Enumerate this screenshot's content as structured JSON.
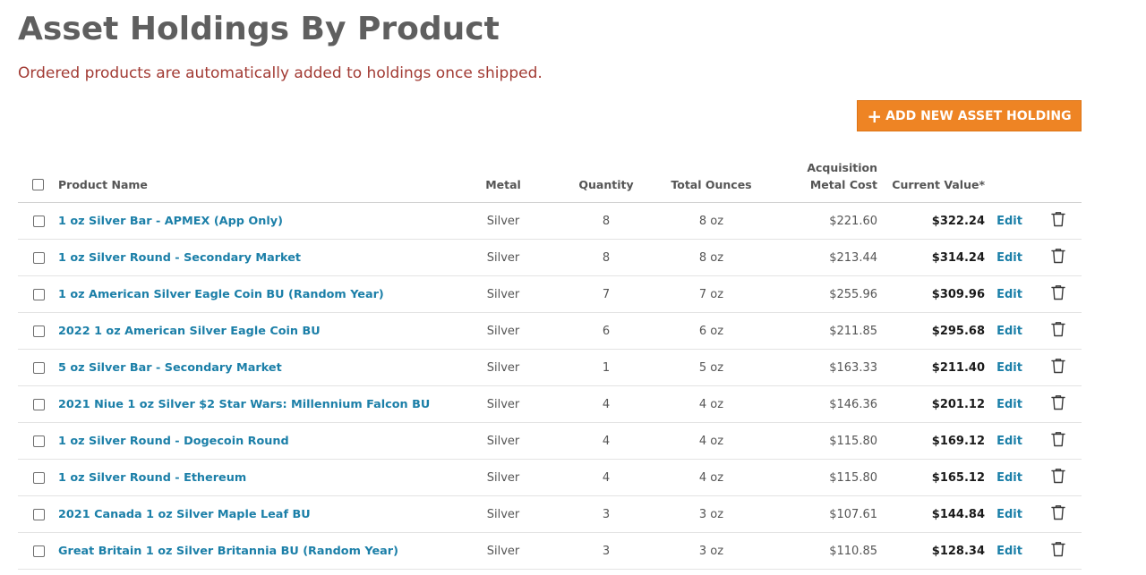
{
  "header": {
    "title": "Asset Holdings By Product",
    "notice": "Ordered products are automatically added to holdings once shipped."
  },
  "actions": {
    "add_label": "ADD NEW ASSET HOLDING",
    "add_icon": "plus-icon"
  },
  "colors": {
    "accent_button": "#ee8424",
    "link": "#1b7fa8",
    "notice": "#a23b34",
    "title": "#5f5f5f"
  },
  "table": {
    "columns": {
      "product_name": "Product Name",
      "metal": "Metal",
      "quantity": "Quantity",
      "total_ounces": "Total Ounces",
      "acquisition_line1": "Acquisition",
      "acquisition_line2": "Metal Cost",
      "current_value": "Current Value*"
    },
    "edit_label": "Edit",
    "delete_icon": "trash-icon",
    "rows": [
      {
        "name": "1 oz Silver Bar - APMEX (App Only)",
        "metal": "Silver",
        "quantity": "8",
        "ounces": "8 oz",
        "cost": "$221.60",
        "value": "$322.24"
      },
      {
        "name": "1 oz Silver Round - Secondary Market",
        "metal": "Silver",
        "quantity": "8",
        "ounces": "8 oz",
        "cost": "$213.44",
        "value": "$314.24"
      },
      {
        "name": "1 oz American Silver Eagle Coin BU (Random Year)",
        "metal": "Silver",
        "quantity": "7",
        "ounces": "7 oz",
        "cost": "$255.96",
        "value": "$309.96"
      },
      {
        "name": "2022 1 oz American Silver Eagle Coin BU",
        "metal": "Silver",
        "quantity": "6",
        "ounces": "6 oz",
        "cost": "$211.85",
        "value": "$295.68"
      },
      {
        "name": "5 oz Silver Bar - Secondary Market",
        "metal": "Silver",
        "quantity": "1",
        "ounces": "5 oz",
        "cost": "$163.33",
        "value": "$211.40"
      },
      {
        "name": "2021 Niue 1 oz Silver $2 Star Wars: Millennium Falcon BU",
        "metal": "Silver",
        "quantity": "4",
        "ounces": "4 oz",
        "cost": "$146.36",
        "value": "$201.12"
      },
      {
        "name": "1 oz Silver Round - Dogecoin Round",
        "metal": "Silver",
        "quantity": "4",
        "ounces": "4 oz",
        "cost": "$115.80",
        "value": "$169.12"
      },
      {
        "name": "1 oz Silver Round - Ethereum",
        "metal": "Silver",
        "quantity": "4",
        "ounces": "4 oz",
        "cost": "$115.80",
        "value": "$165.12"
      },
      {
        "name": "2021 Canada 1 oz Silver Maple Leaf BU",
        "metal": "Silver",
        "quantity": "3",
        "ounces": "3 oz",
        "cost": "$107.61",
        "value": "$144.84"
      },
      {
        "name": "Great Britain 1 oz Silver Britannia BU (Random Year)",
        "metal": "Silver",
        "quantity": "3",
        "ounces": "3 oz",
        "cost": "$110.85",
        "value": "$128.34"
      }
    ]
  }
}
